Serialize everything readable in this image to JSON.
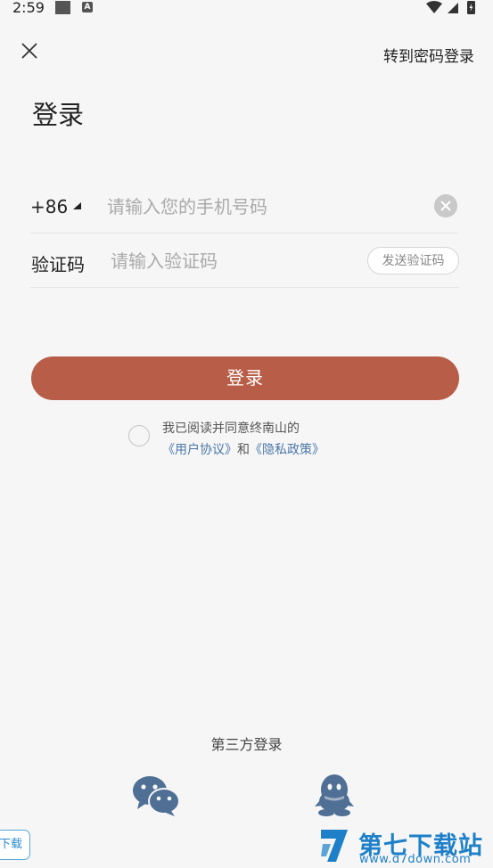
{
  "status_bar": {
    "time": "2:59",
    "notification_icon": "A"
  },
  "header": {
    "close_icon": "close-icon",
    "password_login_link": "转到密码登录"
  },
  "title": "登录",
  "phone_row": {
    "country_code": "+86",
    "placeholder": "请输入您的手机号码",
    "value": ""
  },
  "code_row": {
    "label": "验证码",
    "placeholder": "请输入验证码",
    "value": "",
    "send_button": "发送验证码"
  },
  "login_button": "登录",
  "agreement": {
    "checked": false,
    "text": "我已阅读并同意终南山的",
    "user_agreement": "《用户协议》",
    "and": "和",
    "privacy_policy": "《隐私政策》"
  },
  "third_party": {
    "title": "第三方登录",
    "options": [
      {
        "icon": "wechat-icon"
      },
      {
        "icon": "qq-icon"
      }
    ]
  },
  "watermark": {
    "left_text": "下载",
    "name": "第七下载站",
    "url": "www.d7down.com"
  },
  "colors": {
    "accent": "#b85e48",
    "link": "#4b78a8",
    "third_party_icon": "#4f6f95",
    "background": "#f6f6f6"
  }
}
